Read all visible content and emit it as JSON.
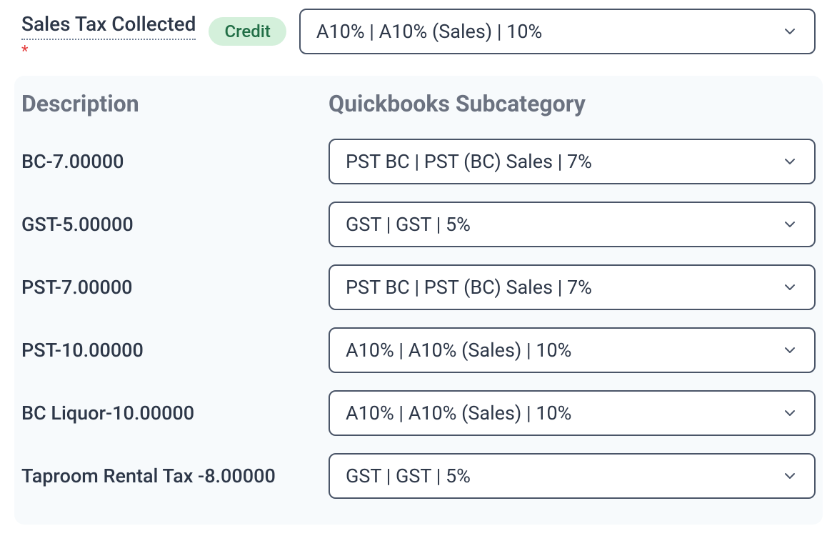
{
  "top": {
    "field_label": "Sales Tax Collected",
    "required_mark": "*",
    "badge": "Credit",
    "select_value": "A10% | A10% (Sales) | 10%"
  },
  "panel": {
    "header_description": "Description",
    "header_subcategory": "Quickbooks Subcategory",
    "rows": [
      {
        "description": "BC-7.00000",
        "subcategory": "PST BC | PST (BC) Sales | 7%"
      },
      {
        "description": "GST-5.00000",
        "subcategory": "GST | GST | 5%"
      },
      {
        "description": "PST-7.00000",
        "subcategory": "PST BC | PST (BC) Sales | 7%"
      },
      {
        "description": "PST-10.00000",
        "subcategory": "A10% | A10% (Sales) | 10%"
      },
      {
        "description": "BC Liquor-10.00000",
        "subcategory": "A10% | A10% (Sales) | 10%"
      },
      {
        "description": "Taproom Rental Tax -8.00000",
        "subcategory": "GST | GST | 5%"
      }
    ]
  }
}
